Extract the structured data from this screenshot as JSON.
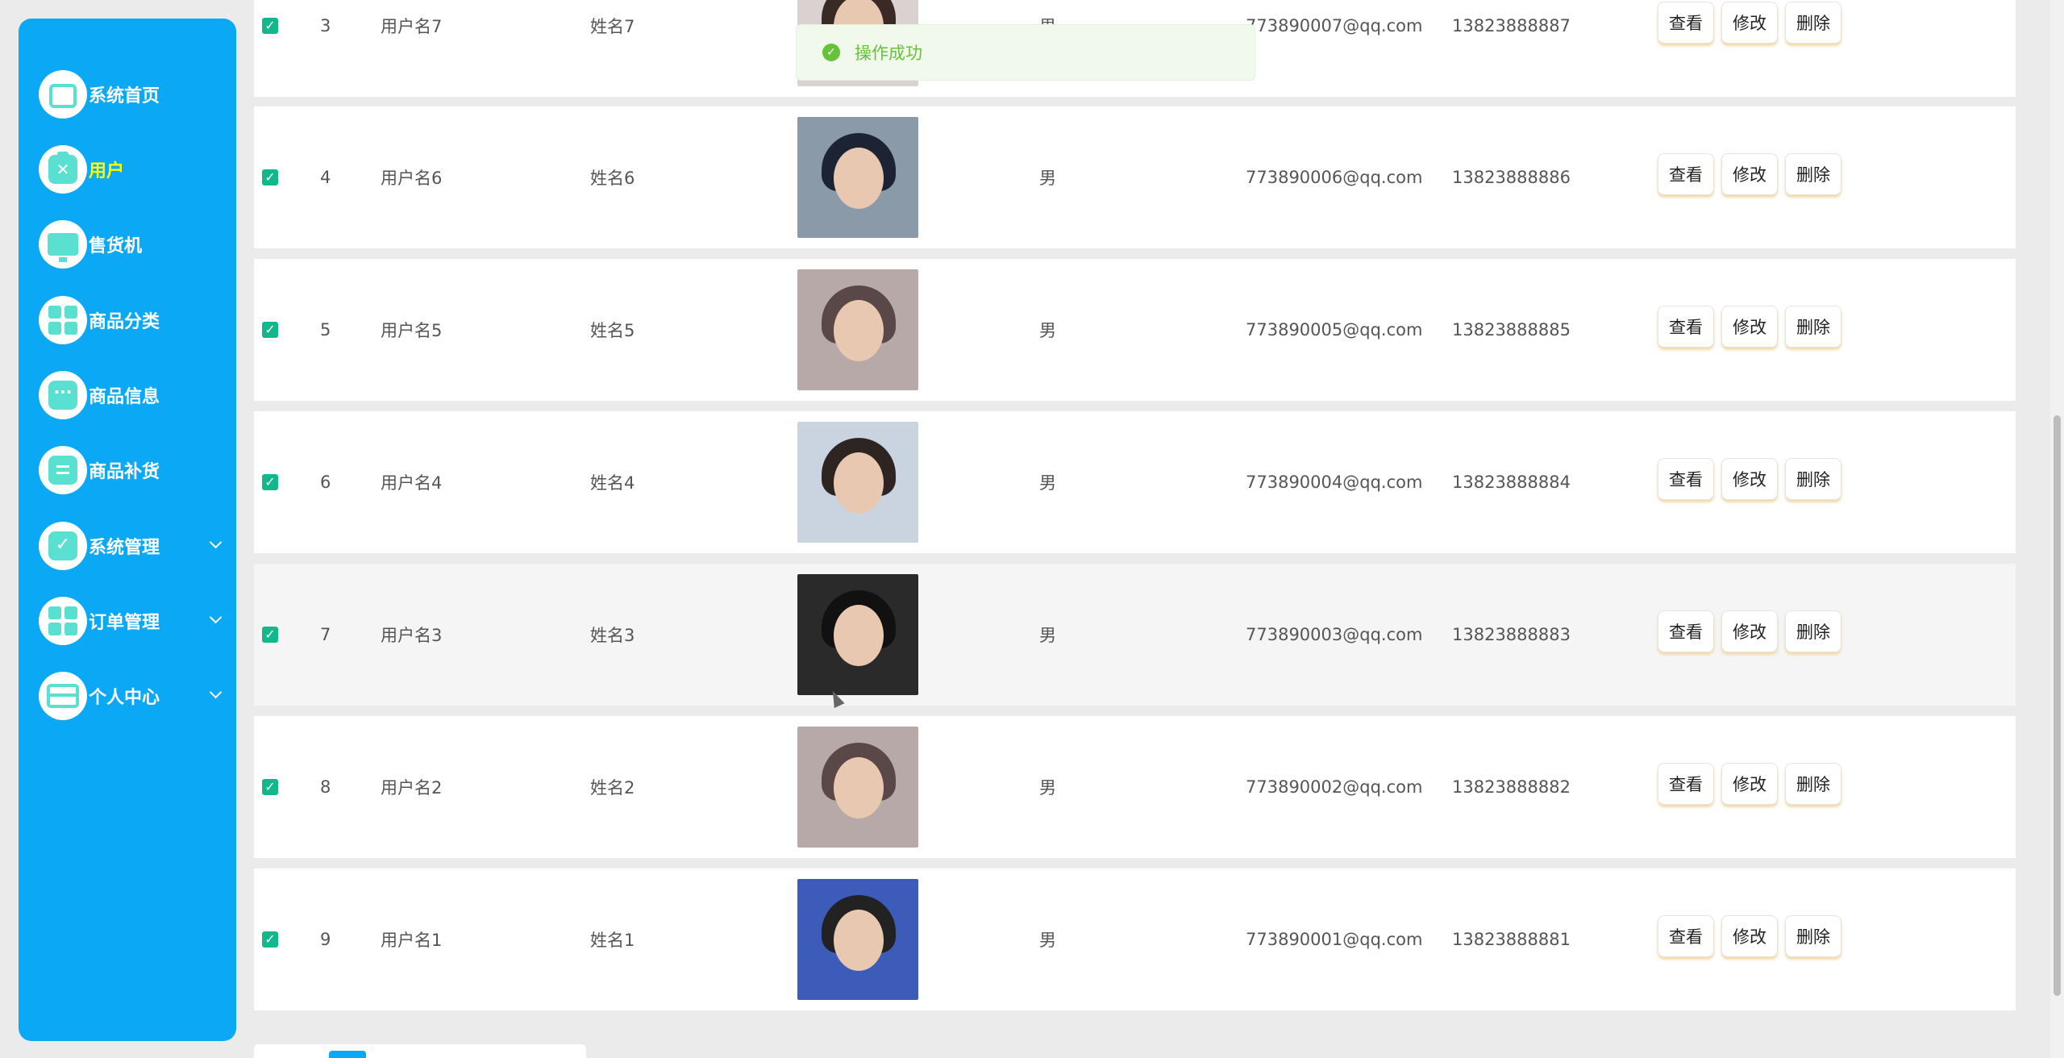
{
  "sidebar": {
    "items": [
      {
        "label": "系统首页",
        "icon": "home-icon"
      },
      {
        "label": "用户",
        "icon": "clipboard-x-icon",
        "active": true
      },
      {
        "label": "售货机",
        "icon": "monitor-icon"
      },
      {
        "label": "商品分类",
        "icon": "grid-icon"
      },
      {
        "label": "商品信息",
        "icon": "chat-icon"
      },
      {
        "label": "商品补货",
        "icon": "clipboard-list-icon"
      },
      {
        "label": "系统管理",
        "icon": "clipboard-check-icon",
        "expandable": true
      },
      {
        "label": "订单管理",
        "icon": "grid-icon",
        "expandable": true
      },
      {
        "label": "个人中心",
        "icon": "card-icon",
        "expandable": true
      }
    ]
  },
  "toast": {
    "text": "操作成功"
  },
  "table": {
    "rows": [
      {
        "index": "3",
        "username": "用户名7",
        "name": "姓名7",
        "sex": "男",
        "email": "773890007@qq.com",
        "phone": "13823888887",
        "checked": true
      },
      {
        "index": "4",
        "username": "用户名6",
        "name": "姓名6",
        "sex": "男",
        "email": "773890006@qq.com",
        "phone": "13823888886",
        "checked": true
      },
      {
        "index": "5",
        "username": "用户名5",
        "name": "姓名5",
        "sex": "男",
        "email": "773890005@qq.com",
        "phone": "13823888885",
        "checked": true
      },
      {
        "index": "6",
        "username": "用户名4",
        "name": "姓名4",
        "sex": "男",
        "email": "773890004@qq.com",
        "phone": "13823888884",
        "checked": true
      },
      {
        "index": "7",
        "username": "用户名3",
        "name": "姓名3",
        "sex": "男",
        "email": "773890003@qq.com",
        "phone": "13823888883",
        "checked": true
      },
      {
        "index": "8",
        "username": "用户名2",
        "name": "姓名2",
        "sex": "男",
        "email": "773890002@qq.com",
        "phone": "13823888882",
        "checked": true
      },
      {
        "index": "9",
        "username": "用户名1",
        "name": "姓名1",
        "sex": "男",
        "email": "773890001@qq.com",
        "phone": "13823888881",
        "checked": true
      }
    ],
    "actions": {
      "view": "查看",
      "edit": "修改",
      "delete": "删除"
    }
  },
  "colors": {
    "sidebar": "#0aa8f5",
    "active": "#ffff00",
    "success": "#67c23a",
    "checkbox": "#13b88a"
  }
}
